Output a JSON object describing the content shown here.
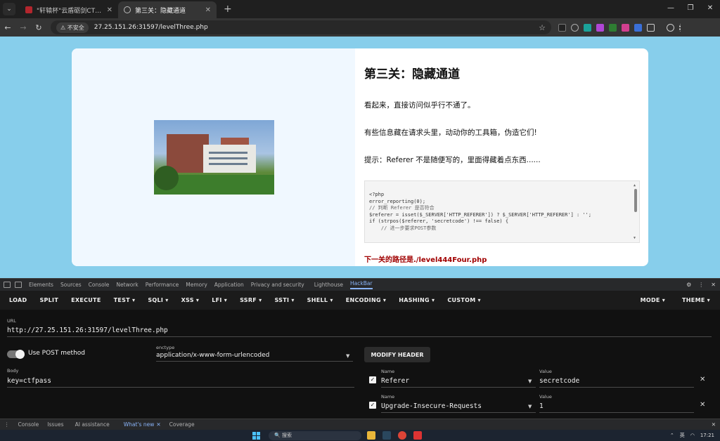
{
  "browser": {
    "tabs": [
      {
        "title": "\"轩辕杯\"云盾砺剑CTF挑战赛",
        "active": false
      },
      {
        "title": "第三关：隐藏通道",
        "active": true
      }
    ],
    "new_tab": "+",
    "window_controls": [
      "—",
      "❐",
      "✕"
    ],
    "insecure_label": "不安全",
    "url": "27.25.151.26:31597/levelThree.php"
  },
  "page": {
    "title": "第三关：隐藏通道",
    "paragraphs": [
      "看起来，直接访问似乎行不通了。",
      "有些信息藏在请求头里，动动你的工具箱，伪造它们!",
      "提示：Referer 不是随便写的，里面得藏着点东西......"
    ],
    "code_lines": [
      "<?php",
      "error_reporting(0);",
      "",
      "// 判断 Referer 是否符合",
      "$referer = isset($_SERVER['HTTP_REFERER']) ? $_SERVER['HTTP_REFERER'] : '';",
      "",
      "if (strpos($referer, 'secretcode') !== false) {",
      "    // 进一步要求POST参数"
    ],
    "next_path": "下一关的路径是./level444Four.php"
  },
  "devtools": {
    "tabs": [
      "Elements",
      "Sources",
      "Console",
      "Network",
      "Performance",
      "Memory",
      "Application",
      "Privacy and security",
      "Lighthouse",
      "HackBar"
    ],
    "active_tab": "HackBar",
    "drawer_tabs": [
      "Console",
      "Issues",
      "AI assistance",
      "What's new",
      "Coverage"
    ],
    "drawer_active": "What's new"
  },
  "hackbar": {
    "menu": [
      "LOAD",
      "SPLIT",
      "EXECUTE",
      "TEST ▾",
      "SQLI ▾",
      "XSS ▾",
      "LFI ▾",
      "SSRF ▾",
      "SSTI ▾",
      "SHELL ▾",
      "ENCODING ▾",
      "HASHING ▾",
      "CUSTOM ▾"
    ],
    "menu_right": [
      "MODE ▾",
      "THEME ▾"
    ],
    "url_label": "URL",
    "url_value": "http://27.25.151.26:31597/levelThree.php",
    "post_toggle_label": "Use POST method",
    "post_enabled": true,
    "enctype_label": "enctype",
    "enctype_value": "application/x-www-form-urlencoded",
    "modify_header_label": "MODIFY HEADER",
    "body_label": "Body",
    "body_value": "key=ctfpass",
    "headers": [
      {
        "name_label": "Name",
        "name": "Referer",
        "value_label": "Value",
        "value": "secretcode",
        "checked": true
      },
      {
        "name_label": "Name",
        "name": "Upgrade-Insecure-Requests",
        "value_label": "Value",
        "value": "1",
        "checked": true
      }
    ]
  },
  "taskbar": {
    "search_placeholder": "搜索",
    "lang": "英",
    "time": "17:21"
  }
}
